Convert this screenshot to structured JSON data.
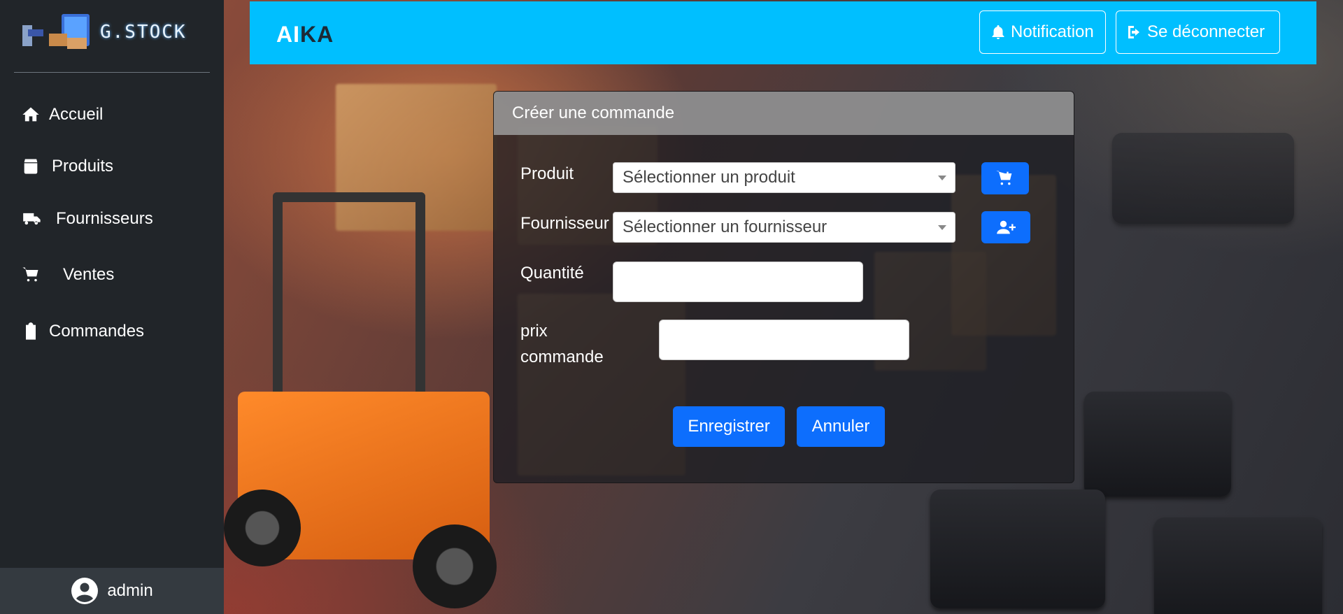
{
  "brand": {
    "name": "G.STOCK"
  },
  "sidebar": {
    "items": [
      {
        "label": "Accueil",
        "icon": "home-icon"
      },
      {
        "label": "Produits",
        "icon": "box-icon"
      },
      {
        "label": "Fournisseurs",
        "icon": "truck-icon"
      },
      {
        "label": "Ventes",
        "icon": "cart-icon"
      },
      {
        "label": "Commandes",
        "icon": "clipboard-icon"
      }
    ],
    "user": {
      "name": "admin",
      "icon": "user-circle-icon"
    }
  },
  "topbar": {
    "logo_part1": "AI",
    "logo_part2": "KA",
    "notification_label": "Notification",
    "logout_label": "Se déconnecter",
    "color": "#00bfff"
  },
  "form": {
    "title": "Créer une commande",
    "produit": {
      "label": "Produit",
      "placeholder": "Sélectionner un produit",
      "add_icon": "cart-plus-icon"
    },
    "fournisseur": {
      "label": "Fournisseur",
      "placeholder": "Sélectionner un fournisseur",
      "add_icon": "user-plus-icon"
    },
    "quantite": {
      "label": "Quantité",
      "value": ""
    },
    "prix": {
      "label_line1": "prix",
      "label_line2": "commande",
      "value": ""
    },
    "save_label": "Enregistrer",
    "cancel_label": "Annuler",
    "accent": "#0d6efd"
  }
}
